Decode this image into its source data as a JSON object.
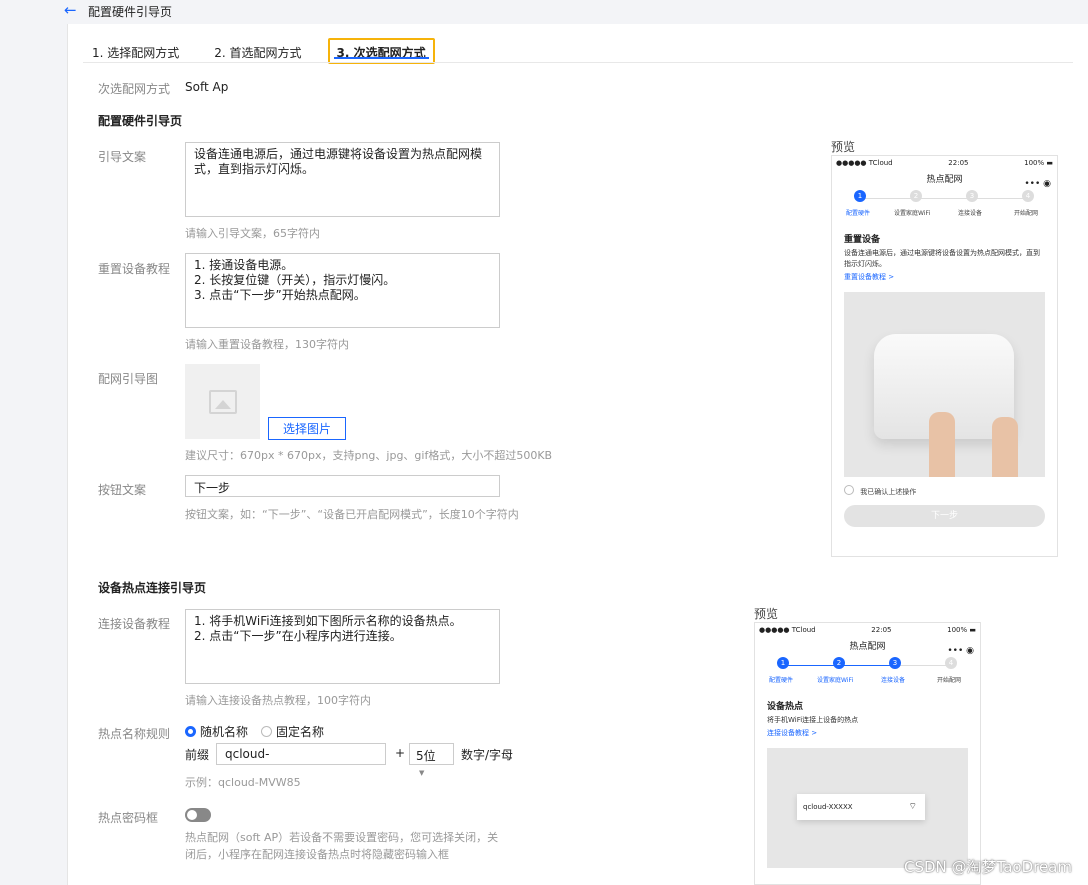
{
  "header": {
    "back_icon": "arrow-left-icon",
    "title": "配置硬件引导页"
  },
  "tabs": [
    {
      "label": "1. 选择配网方式",
      "active": false
    },
    {
      "label": "2. 首选配网方式",
      "active": false
    },
    {
      "label": "3. 次选配网方式",
      "active": true
    }
  ],
  "secondary_method": {
    "label": "次选配网方式",
    "value": "Soft Ap"
  },
  "guide_section": {
    "title": "配置硬件引导页",
    "guide_text": {
      "label": "引导文案",
      "value": "设备连通电源后，通过电源键将设备设置为热点配网模式，直到指示灯闪烁。",
      "hint": "请输入引导文案，65字符内"
    },
    "reset_tutorial": {
      "label": "重置设备教程",
      "value": "1. 接通设备电源。\n2. 长按复位键（开关），指示灯慢闪。\n3. 点击“下一步”开始热点配网。",
      "hint": "请输入重置设备教程，130字符内"
    },
    "guide_image": {
      "label": "配网引导图",
      "button": "选择图片",
      "hint": "建议尺寸：670px * 670px，支持png、jpg、gif格式，大小不超过500KB"
    },
    "button_text": {
      "label": "按钮文案",
      "value": "下一步",
      "hint": "按钮文案，如：“下一步”、“设备已开启配网模式”，长度10个字符内"
    }
  },
  "preview1": {
    "label": "预览",
    "status_left": "●●●●● TCloud",
    "status_time": "22:05",
    "status_right": "100% ▬",
    "nav_title": "热点配网",
    "nav_capsule": "•••  ◉",
    "steps": [
      "配置硬件",
      "设置家庭WiFi",
      "连接设备",
      "开始配网"
    ],
    "step_nums": [
      "1",
      "2",
      "3",
      "4"
    ],
    "heading": "重置设备",
    "desc": "设备连通电源后，通过电源键将设备设置为热点配网模式，直到指示灯闪烁。",
    "link": "重置设备教程 >",
    "confirm": "我已确认上述操作",
    "button": "下一步"
  },
  "hotspot_section": {
    "title": "设备热点连接引导页",
    "connect_tutorial": {
      "label": "连接设备教程",
      "value": "1. 将手机WiFi连接到如下图所示名称的设备热点。\n2. 点击“下一步”在小程序内进行连接。",
      "hint": "请输入连接设备热点教程，100字符内"
    },
    "name_rule": {
      "label": "热点名称规则",
      "option_random": "随机名称",
      "option_fixed": "固定名称",
      "prefix_label": "前缀",
      "prefix_value": "qcloud-",
      "plus": "+",
      "digits": "5位",
      "suffix_label": "数字/字母",
      "example": "示例：qcloud-MVW85"
    },
    "password_box": {
      "label": "热点密码框",
      "hint": "热点配网（soft AP）若设备不需要设置密码，您可选择关闭，关闭后，小程序在配网连接设备热点时将隐藏密码输入框"
    }
  },
  "preview2": {
    "label": "预览",
    "status_left": "●●●●● TCloud",
    "status_time": "22:05",
    "status_right": "100% ▬",
    "nav_title": "热点配网",
    "nav_capsule": "•••  ◉",
    "steps": [
      "配置硬件",
      "设置家庭WiFi",
      "连接设备",
      "开始配网"
    ],
    "step_nums": [
      "1",
      "2",
      "3",
      "4"
    ],
    "heading": "设备热点",
    "desc": "将手机WiFi连接上设备的热点",
    "link": "连接设备教程 >",
    "wifi_name": "qcloud-XXXXX"
  },
  "watermark": "CSDN @淘梦TaoDream",
  "colors": {
    "accent": "#1a66ff",
    "highlight": "#f6b30a"
  }
}
